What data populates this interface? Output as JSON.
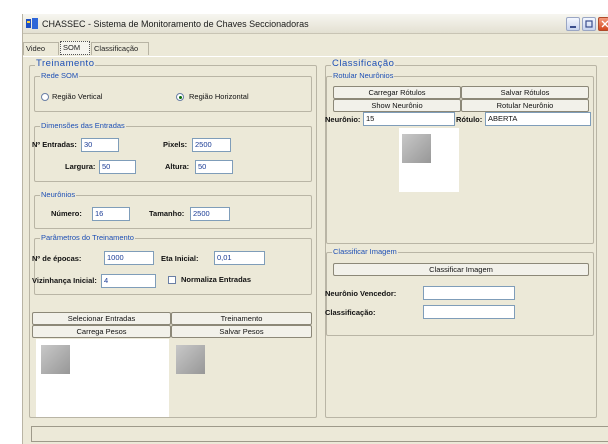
{
  "window": {
    "title": "CHASSEC - Sistema de Monitoramento de Chaves Seccionadoras",
    "icon": "app-logo-icon"
  },
  "tabs": [
    {
      "label": "Video"
    },
    {
      "label": "SOM"
    },
    {
      "label": "Classificação"
    }
  ],
  "active_tab": "SOM",
  "treinamento": {
    "title": "Treinamento",
    "rede_som": {
      "title": "Rede SOM",
      "options": [
        "Região Vertical",
        "Região Horizontal"
      ],
      "selected": "Região Horizontal"
    },
    "dimensoes": {
      "title": "Dimensões das Entradas",
      "n_entradas_label": "Nº Entradas:",
      "n_entradas_value": "30",
      "pixels_label": "Pixels:",
      "pixels_value": "2500",
      "largura_label": "Largura:",
      "largura_value": "50",
      "altura_label": "Altura:",
      "altura_value": "50"
    },
    "neuronios": {
      "title": "Neurônios",
      "numero_label": "Número:",
      "numero_value": "16",
      "tamanho_label": "Tamanho:",
      "tamanho_value": "2500"
    },
    "parametros": {
      "title": "Parâmetros do Treinamento",
      "epocas_label": "Nº de épocas:",
      "epocas_value": "1000",
      "eta_label": "Eta Inicial:",
      "eta_value": "0,01",
      "vizinhanca_label": "Vizinhança Inicial:",
      "vizinhanca_value": "4",
      "normaliza_label": "Normaliza Entradas",
      "normaliza_checked": false
    },
    "buttons": {
      "selecionar": "Selecionar Entradas",
      "treinamento": "Treinamento",
      "carrega": "Carrega Pesos",
      "salvar": "Salvar Pesos"
    }
  },
  "classificacao": {
    "title": "Classificação",
    "rotular": {
      "title": "Rotular Neurônios",
      "carregar": "Carregar Rótulos",
      "salvar": "Salvar Rótulos",
      "show": "Show Neurônio",
      "rotular": "Rotular Neurônio",
      "neuronio_label": "Neurônio:",
      "neuronio_value": "15",
      "rotulo_label": "Rótulo:",
      "rotulo_value": "ABERTA"
    },
    "classificar": {
      "title": "Classificar Imagem",
      "button": "Classificar Imagem",
      "vencedor_label": "Neurônio Vencedor:",
      "vencedor_value": "",
      "classificacao_label": "Classificação:",
      "classificacao_value": ""
    }
  },
  "colors": {
    "group_title": "#1d4fb5",
    "background": "#ece9d8",
    "field_text": "#1b3c96"
  }
}
